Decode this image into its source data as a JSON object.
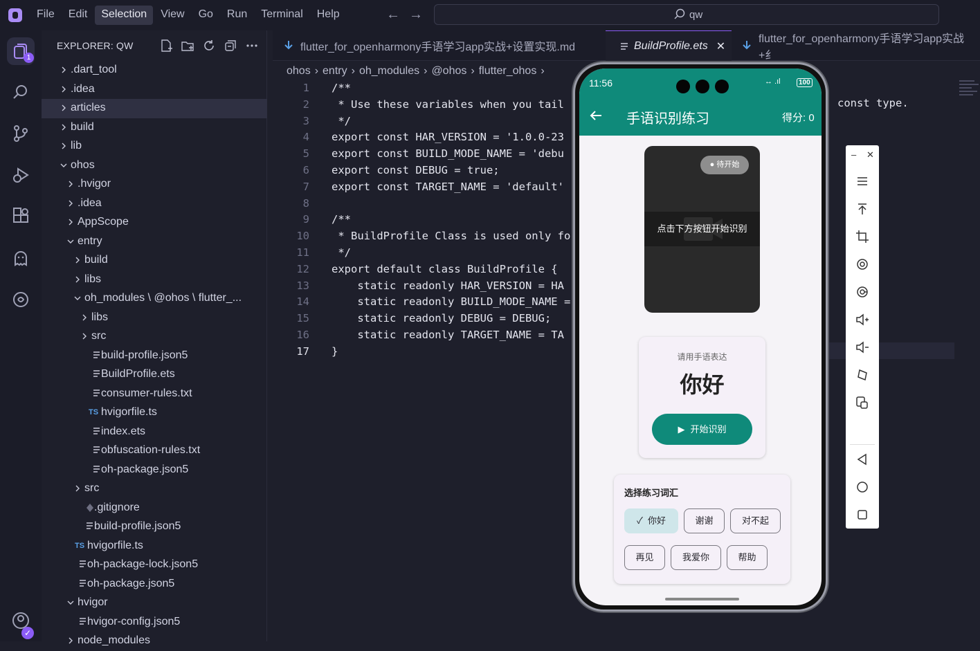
{
  "menu": [
    "File",
    "Edit",
    "Selection",
    "View",
    "Go",
    "Run",
    "Terminal",
    "Help"
  ],
  "menu_active": "Selection",
  "search": {
    "text": "qw"
  },
  "explorer": {
    "title": "EXPLORER: QW",
    "tree": [
      {
        "label": ".dart_tool",
        "type": "folder",
        "open": false,
        "depth": 0
      },
      {
        "label": ".idea",
        "type": "folder",
        "open": false,
        "depth": 0
      },
      {
        "label": "articles",
        "type": "folder",
        "open": false,
        "depth": 0,
        "selected": true
      },
      {
        "label": "build",
        "type": "folder",
        "open": false,
        "depth": 0
      },
      {
        "label": "lib",
        "type": "folder",
        "open": false,
        "depth": 0
      },
      {
        "label": "ohos",
        "type": "folder",
        "open": true,
        "depth": 0
      },
      {
        "label": ".hvigor",
        "type": "folder",
        "open": false,
        "depth": 1
      },
      {
        "label": ".idea",
        "type": "folder",
        "open": false,
        "depth": 1
      },
      {
        "label": "AppScope",
        "type": "folder",
        "open": false,
        "depth": 1
      },
      {
        "label": "entry",
        "type": "folder",
        "open": true,
        "depth": 1
      },
      {
        "label": "build",
        "type": "folder",
        "open": false,
        "depth": 2
      },
      {
        "label": "libs",
        "type": "folder",
        "open": false,
        "depth": 2
      },
      {
        "label": "oh_modules \\ @ohos \\ flutter_...",
        "type": "folder",
        "open": true,
        "depth": 2
      },
      {
        "label": "libs",
        "type": "folder",
        "open": false,
        "depth": 3
      },
      {
        "label": "src",
        "type": "folder",
        "open": false,
        "depth": 3
      },
      {
        "label": "build-profile.json5",
        "type": "file",
        "depth": 3
      },
      {
        "label": "BuildProfile.ets",
        "type": "file",
        "depth": 3
      },
      {
        "label": "consumer-rules.txt",
        "type": "file",
        "depth": 3
      },
      {
        "label": "hvigorfile.ts",
        "type": "ts",
        "depth": 3
      },
      {
        "label": "index.ets",
        "type": "file",
        "depth": 3
      },
      {
        "label": "obfuscation-rules.txt",
        "type": "file",
        "depth": 3
      },
      {
        "label": "oh-package.json5",
        "type": "file",
        "depth": 3
      },
      {
        "label": "src",
        "type": "folder",
        "open": false,
        "depth": 2
      },
      {
        "label": ".gitignore",
        "type": "git",
        "depth": 2
      },
      {
        "label": "build-profile.json5",
        "type": "file",
        "depth": 2
      },
      {
        "label": "hvigorfile.ts",
        "type": "ts",
        "depth": 1
      },
      {
        "label": "oh-package-lock.json5",
        "type": "file",
        "depth": 1
      },
      {
        "label": "oh-package.json5",
        "type": "file",
        "depth": 1
      },
      {
        "label": "hvigor",
        "type": "folder",
        "open": true,
        "depth": 1
      },
      {
        "label": "hvigor-config.json5",
        "type": "file",
        "depth": 1
      },
      {
        "label": "node_modules",
        "type": "folder",
        "open": false,
        "depth": 1
      }
    ]
  },
  "tabs": [
    {
      "label": "flutter_for_openharmony手语学习app实战+设置实现.md",
      "active": false
    },
    {
      "label": "BuildProfile.ets",
      "active": true
    },
    {
      "label": "flutter_for_openharmony手语学习app实战+纟",
      "active": false
    }
  ],
  "breadcrumbs": [
    "ohos",
    "entry",
    "oh_modules",
    "@ohos",
    "flutter_ohos"
  ],
  "code": [
    "/**",
    " * Use these variables when you tail",
    " */",
    "export const HAR_VERSION = '1.0.0-23",
    "export const BUILD_MODE_NAME = 'debu",
    "export const DEBUG = true;",
    "export const TARGET_NAME = 'default'",
    "",
    "/**",
    " * BuildProfile Class is used only fo",
    " */",
    "export default class BuildProfile {",
    "    static readonly HAR_VERSION = HA",
    "    static readonly BUILD_MODE_NAME =",
    "    static readonly DEBUG = DEBUG;",
    "    static readonly TARGET_NAME = TA",
    "}"
  ],
  "code_tail": "const type.",
  "current_line": 17,
  "phone": {
    "time": "11:56",
    "battery": "100",
    "title": "手语识别练习",
    "score": "得分: 0",
    "status_pill": "待开始",
    "hint": "点击下方按钮开始识别",
    "prompt_label": "请用手语表达",
    "word": "你好",
    "start_button": "开始识别",
    "vocab_title": "选择练习词汇",
    "vocab": [
      "你好",
      "谢谢",
      "对不起",
      "再见",
      "我爱你",
      "帮助"
    ],
    "vocab_selected": "你好"
  },
  "colors": {
    "accent": "#8b5cf6",
    "phone_primary": "#0f8a7a",
    "chip_selected": "#cfe6ea"
  }
}
